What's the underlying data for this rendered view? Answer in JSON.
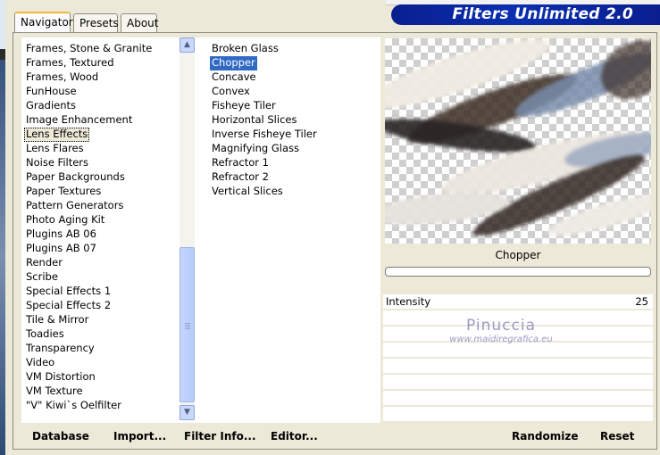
{
  "app": {
    "title": "Filters Unlimited 2.0"
  },
  "tabs": [
    {
      "label": "Navigator",
      "active": true
    },
    {
      "label": "Presets",
      "active": false
    },
    {
      "label": "About",
      "active": false
    }
  ],
  "categories": {
    "items": [
      "Frames, Stone & Granite",
      "Frames, Textured",
      "Frames, Wood",
      "FunHouse",
      "Gradients",
      "Image Enhancement",
      "Lens Effects",
      "Lens Flares",
      "Noise Filters",
      "Paper Backgrounds",
      "Paper Textures",
      "Pattern Generators",
      "Photo Aging Kit",
      "Plugins AB 06",
      "Plugins AB 07",
      "Render",
      "Scribe",
      "Special Effects 1",
      "Special Effects 2",
      "Tile & Mirror",
      "Toadies",
      "Transparency",
      "Video",
      "VM Distortion",
      "VM Texture",
      "\"V\" Kiwi`s Oelfilter"
    ],
    "selected": "Lens Effects"
  },
  "filters": {
    "items": [
      "Broken Glass",
      "Chopper",
      "Concave",
      "Convex",
      "Fisheye Tiler",
      "Horizontal Slices",
      "Inverse Fisheye Tiler",
      "Magnifying Glass",
      "Refractor 1",
      "Refractor 2",
      "Vertical Slices"
    ],
    "selected": "Chopper"
  },
  "preview": {
    "filter_name": "Chopper"
  },
  "params": [
    {
      "name": "Intensity",
      "value": "25"
    }
  ],
  "watermark": {
    "title": "Pinuccia",
    "url": "www.maidiregrafica.eu"
  },
  "buttons": {
    "database": "Database",
    "import": "Import...",
    "filter_info": "Filter Info...",
    "editor": "Editor...",
    "randomize": "Randomize",
    "reset": "Reset"
  },
  "icons": {
    "scroll_up": "chevron-up-icon",
    "scroll_down": "chevron-down-icon"
  },
  "colors": {
    "selection": "#316ac5",
    "banner": "#0b2fb0",
    "window_bg": "#ece9d8"
  }
}
